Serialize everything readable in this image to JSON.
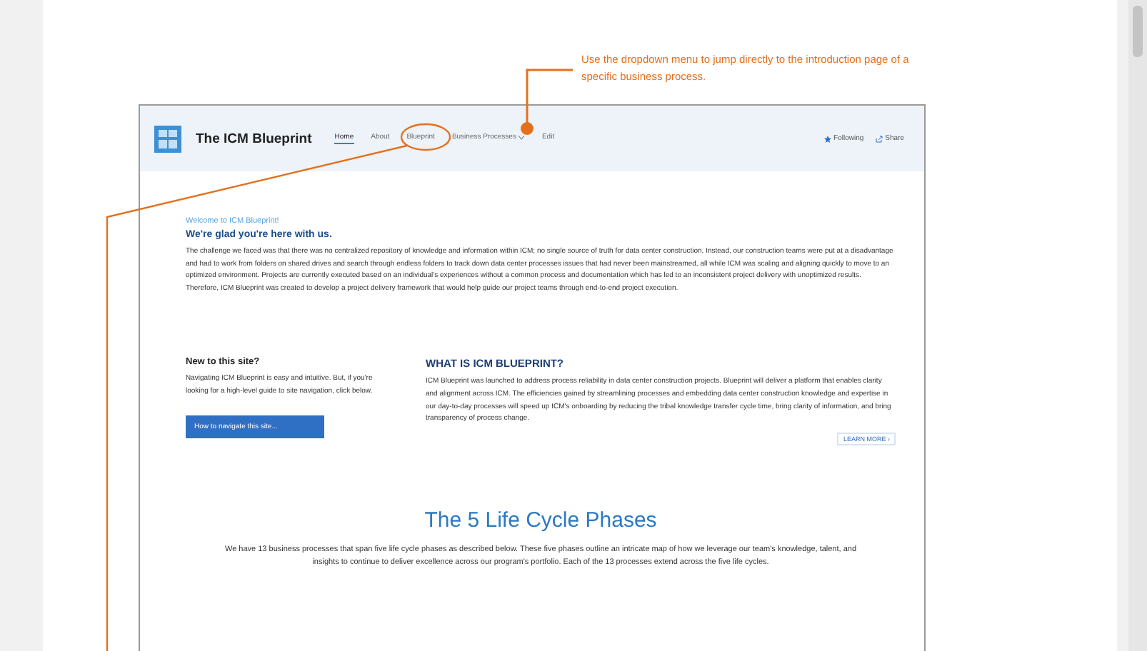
{
  "callout": {
    "text": "Use the dropdown menu to jump directly to the introduction page of  a specific business process."
  },
  "site": {
    "title": "The ICM Blueprint"
  },
  "nav": {
    "items": [
      {
        "label": "Home",
        "selected": true,
        "kind": "link"
      },
      {
        "label": "About",
        "selected": false,
        "kind": "link"
      },
      {
        "label": "Blueprint",
        "selected": false,
        "kind": "link"
      },
      {
        "label": "Business Processes",
        "selected": false,
        "kind": "dropdown"
      },
      {
        "label": "Edit",
        "selected": false,
        "kind": "link"
      }
    ],
    "actions": [
      {
        "label": "Following",
        "kind": "star"
      },
      {
        "label": "Share",
        "kind": "share"
      }
    ]
  },
  "welcome": {
    "kicker": "Welcome to ICM Blueprint!",
    "heading": "We're glad you're here with us.",
    "body": "The challenge we faced was that there was no centralized repository of knowledge and information within ICM; no single source of truth for data center construction. Instead, our construction teams were put at a disadvantage and had to work from folders on shared drives and search through endless folders to track down data center processes issues that had never been mainstreamed, all while ICM was scaling and aligning quickly to move to an optimized environment. Projects are currently executed based on an individual's experiences without a common process and documentation which has led to an inconsistent project delivery with unoptimized results. Therefore, ICM Blueprint was created to develop a project delivery framework that would help guide our project teams through end-to-end project execution."
  },
  "new_to_site": {
    "heading": "New to this site?",
    "body": "Navigating ICM Blueprint is easy and intuitive. But, if you're looking for a high-level guide to site navigation, click below.",
    "button": "How to navigate this site..."
  },
  "about": {
    "heading": "WHAT IS ICM BLUEPRINT?",
    "body": "ICM Blueprint was launched to address process reliability in data center construction projects. Blueprint will deliver a platform that enables clarity and alignment across ICM. The efficiencies gained by streamlining processes and embedding data center construction knowledge and expertise in our day-to-day processes will speed up ICM's onboarding by reducing the tribal knowledge transfer cycle time, bring clarity of information, and bring transparency of process change.",
    "link": "LEARN MORE ›"
  },
  "phases": {
    "heading": "The 5 Life Cycle Phases",
    "body": "We have 13 business processes that span five life cycle phases as described below. These five phases outline an intricate map of how we leverage our team's knowledge, talent, and insights to continue to deliver excellence across our program's portfolio. Each of the 13 processes extend across the five life cycles."
  }
}
